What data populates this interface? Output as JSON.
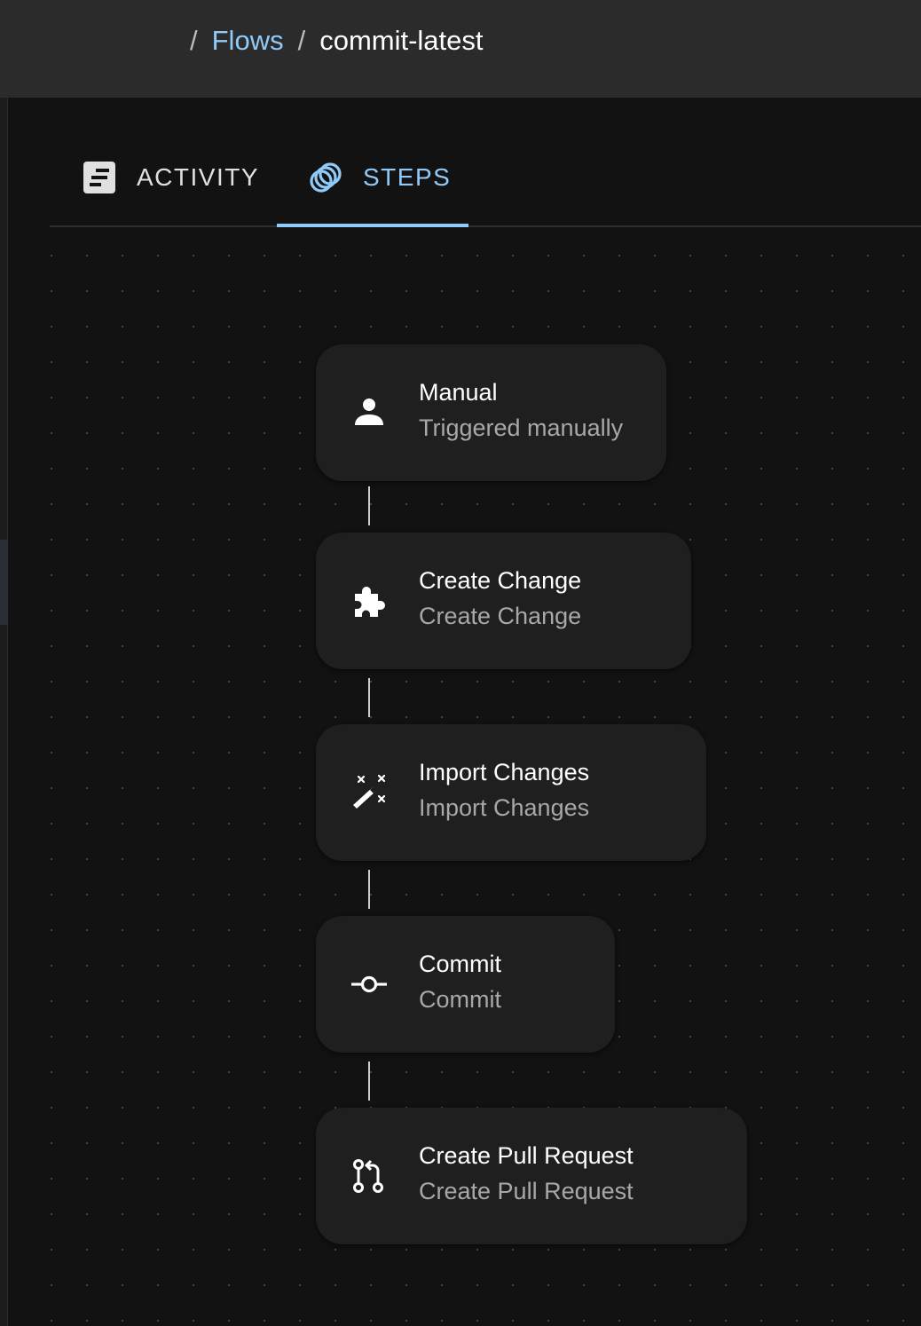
{
  "breadcrumb": {
    "separator": "/",
    "parent": "Flows",
    "current": "commit-latest"
  },
  "tabs": [
    {
      "label": "ACTIVITY",
      "icon": "activity-list-icon",
      "active": false
    },
    {
      "label": "STEPS",
      "icon": "steps-rings-icon",
      "active": true
    }
  ],
  "steps": [
    {
      "title": "Manual",
      "subtitle": "Triggered manually",
      "icon": "person-icon"
    },
    {
      "title": "Create Change",
      "subtitle": "Create Change",
      "icon": "puzzle-icon"
    },
    {
      "title": "Import Changes",
      "subtitle": "Import Changes",
      "icon": "magic-wand-icon"
    },
    {
      "title": "Commit",
      "subtitle": "Commit",
      "icon": "commit-icon"
    },
    {
      "title": "Create Pull Request",
      "subtitle": "Create Pull Request",
      "icon": "pull-request-icon"
    }
  ],
  "colors": {
    "accent": "#90caf9",
    "background": "#121212",
    "topbar": "#2b2b2b",
    "node": "#1f1f1f",
    "muted_text": "#a8a8a8"
  }
}
